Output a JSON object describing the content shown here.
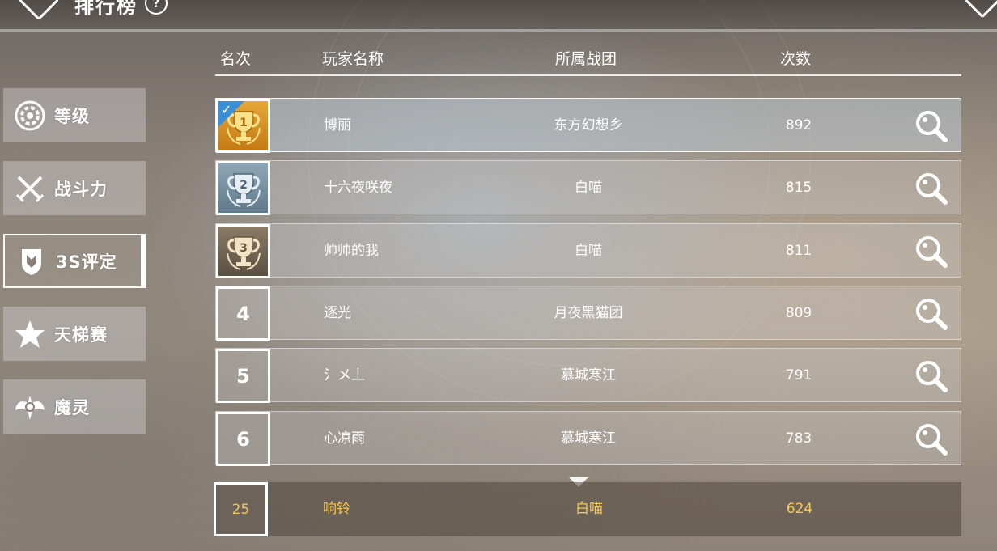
{
  "header": {
    "title": "排行榜",
    "help_symbol": "?"
  },
  "sidebar": {
    "items": [
      {
        "label": "等级",
        "icon": "level-gear-icon"
      },
      {
        "label": "战斗力",
        "icon": "crossed-swords-icon"
      },
      {
        "label": "3S评定",
        "icon": "shield-crest-icon",
        "active": true
      },
      {
        "label": "天梯赛",
        "icon": "star-icon"
      },
      {
        "label": "魔灵",
        "icon": "winged-spirit-icon"
      }
    ]
  },
  "table": {
    "columns": [
      "名次",
      "玩家名称",
      "所属战团",
      "次数"
    ],
    "rows": [
      {
        "rank": "1",
        "name": "博丽",
        "team": "东方幻想乡",
        "count": "892",
        "trophy": "gold",
        "selected": true
      },
      {
        "rank": "2",
        "name": "十六夜咲夜",
        "team": "白喵",
        "count": "815",
        "trophy": "silver"
      },
      {
        "rank": "3",
        "name": "帅帅的我",
        "team": "白喵",
        "count": "811",
        "trophy": "bronze"
      },
      {
        "rank": "4",
        "name": "逐光",
        "team": "月夜黑猫团",
        "count": "809"
      },
      {
        "rank": "5",
        "name": "氵メ丄",
        "team": "慕城寒江",
        "count": "791"
      },
      {
        "rank": "6",
        "name": "心凉雨",
        "team": "慕城寒江",
        "count": "783"
      }
    ]
  },
  "self_row": {
    "rank": "25",
    "name": "响铃",
    "team": "白喵",
    "count": "624"
  },
  "colors": {
    "self_text": "#f5c85a",
    "gold": "#e7a63a",
    "silver": "#8fa6b6",
    "bronze": "#8a7a66",
    "badge_blue": "#3a8fd6"
  }
}
